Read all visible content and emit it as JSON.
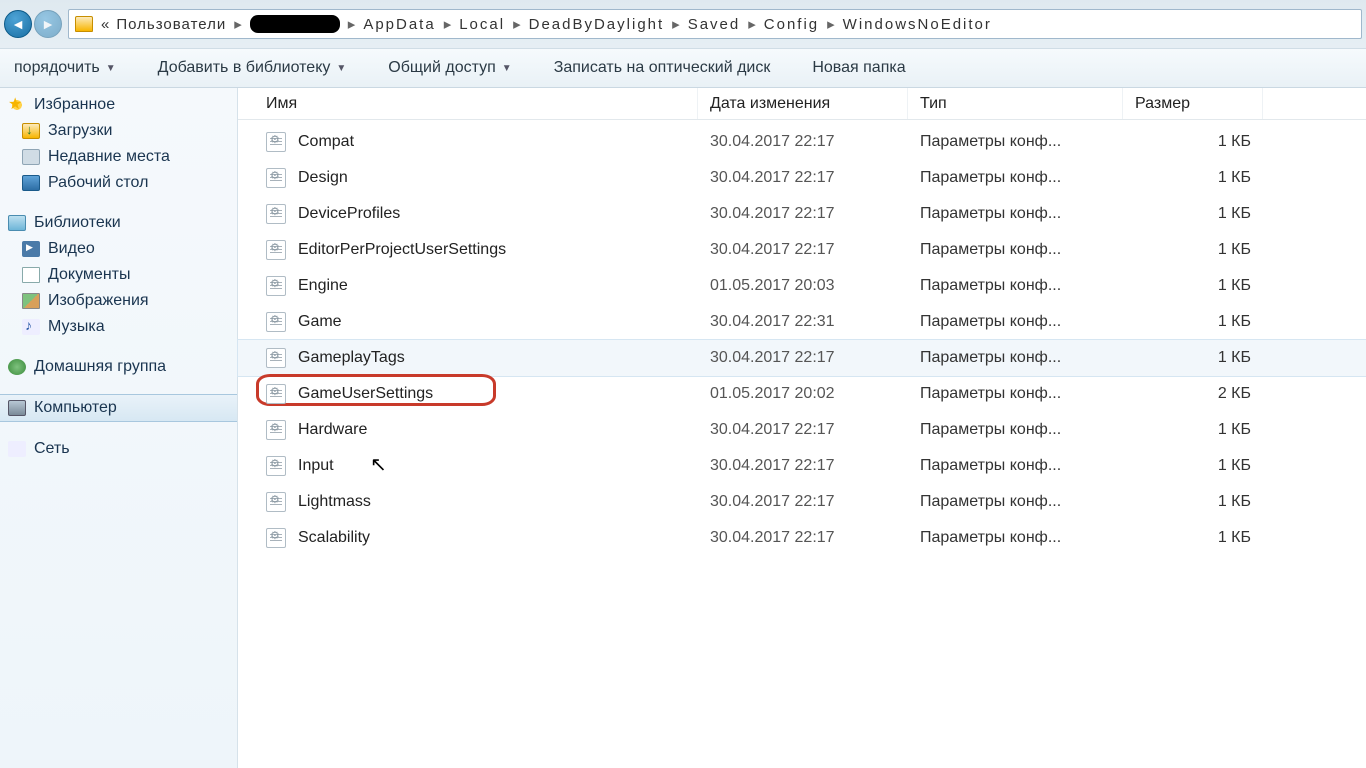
{
  "breadcrumb": {
    "prefix": "«",
    "items": [
      "Пользователи",
      "",
      "AppData",
      "Local",
      "DeadByDaylight",
      "Saved",
      "Config",
      "WindowsNoEditor"
    ]
  },
  "toolbar": {
    "organize": "порядочить",
    "addlib": "Добавить в библиотеку",
    "share": "Общий доступ",
    "burn": "Записать на оптический диск",
    "newfolder": "Новая папка"
  },
  "sidebar": {
    "favorites": {
      "label": "Избранное",
      "items": [
        {
          "label": "Загрузки",
          "icon": "dl"
        },
        {
          "label": "Недавние места",
          "icon": "recent"
        },
        {
          "label": "Рабочий стол",
          "icon": "desktop"
        }
      ]
    },
    "libraries": {
      "label": "Библиотеки",
      "items": [
        {
          "label": "Видео",
          "icon": "vid"
        },
        {
          "label": "Документы",
          "icon": "doc"
        },
        {
          "label": "Изображения",
          "icon": "img"
        },
        {
          "label": "Музыка",
          "icon": "mus"
        }
      ]
    },
    "homegroup": {
      "label": "Домашняя группа"
    },
    "computer": {
      "label": "Компьютер"
    },
    "network": {
      "label": "Сеть"
    }
  },
  "columns": {
    "name": "Имя",
    "date": "Дата изменения",
    "type": "Тип",
    "size": "Размер"
  },
  "typetext": "Параметры конф...",
  "files": [
    {
      "name": "Compat",
      "date": "30.04.2017 22:17",
      "size": "1 КБ"
    },
    {
      "name": "Design",
      "date": "30.04.2017 22:17",
      "size": "1 КБ"
    },
    {
      "name": "DeviceProfiles",
      "date": "30.04.2017 22:17",
      "size": "1 КБ"
    },
    {
      "name": "EditorPerProjectUserSettings",
      "date": "30.04.2017 22:17",
      "size": "1 КБ"
    },
    {
      "name": "Engine",
      "date": "01.05.2017 20:03",
      "size": "1 КБ"
    },
    {
      "name": "Game",
      "date": "30.04.2017 22:31",
      "size": "1 КБ"
    },
    {
      "name": "GameplayTags",
      "date": "30.04.2017 22:17",
      "size": "1 КБ",
      "hovered": true
    },
    {
      "name": "GameUserSettings",
      "date": "01.05.2017 20:02",
      "size": "2 КБ",
      "circled": true
    },
    {
      "name": "Hardware",
      "date": "30.04.2017 22:17",
      "size": "1 КБ"
    },
    {
      "name": "Input",
      "date": "30.04.2017 22:17",
      "size": "1 КБ"
    },
    {
      "name": "Lightmass",
      "date": "30.04.2017 22:17",
      "size": "1 КБ"
    },
    {
      "name": "Scalability",
      "date": "30.04.2017 22:17",
      "size": "1 КБ"
    }
  ]
}
